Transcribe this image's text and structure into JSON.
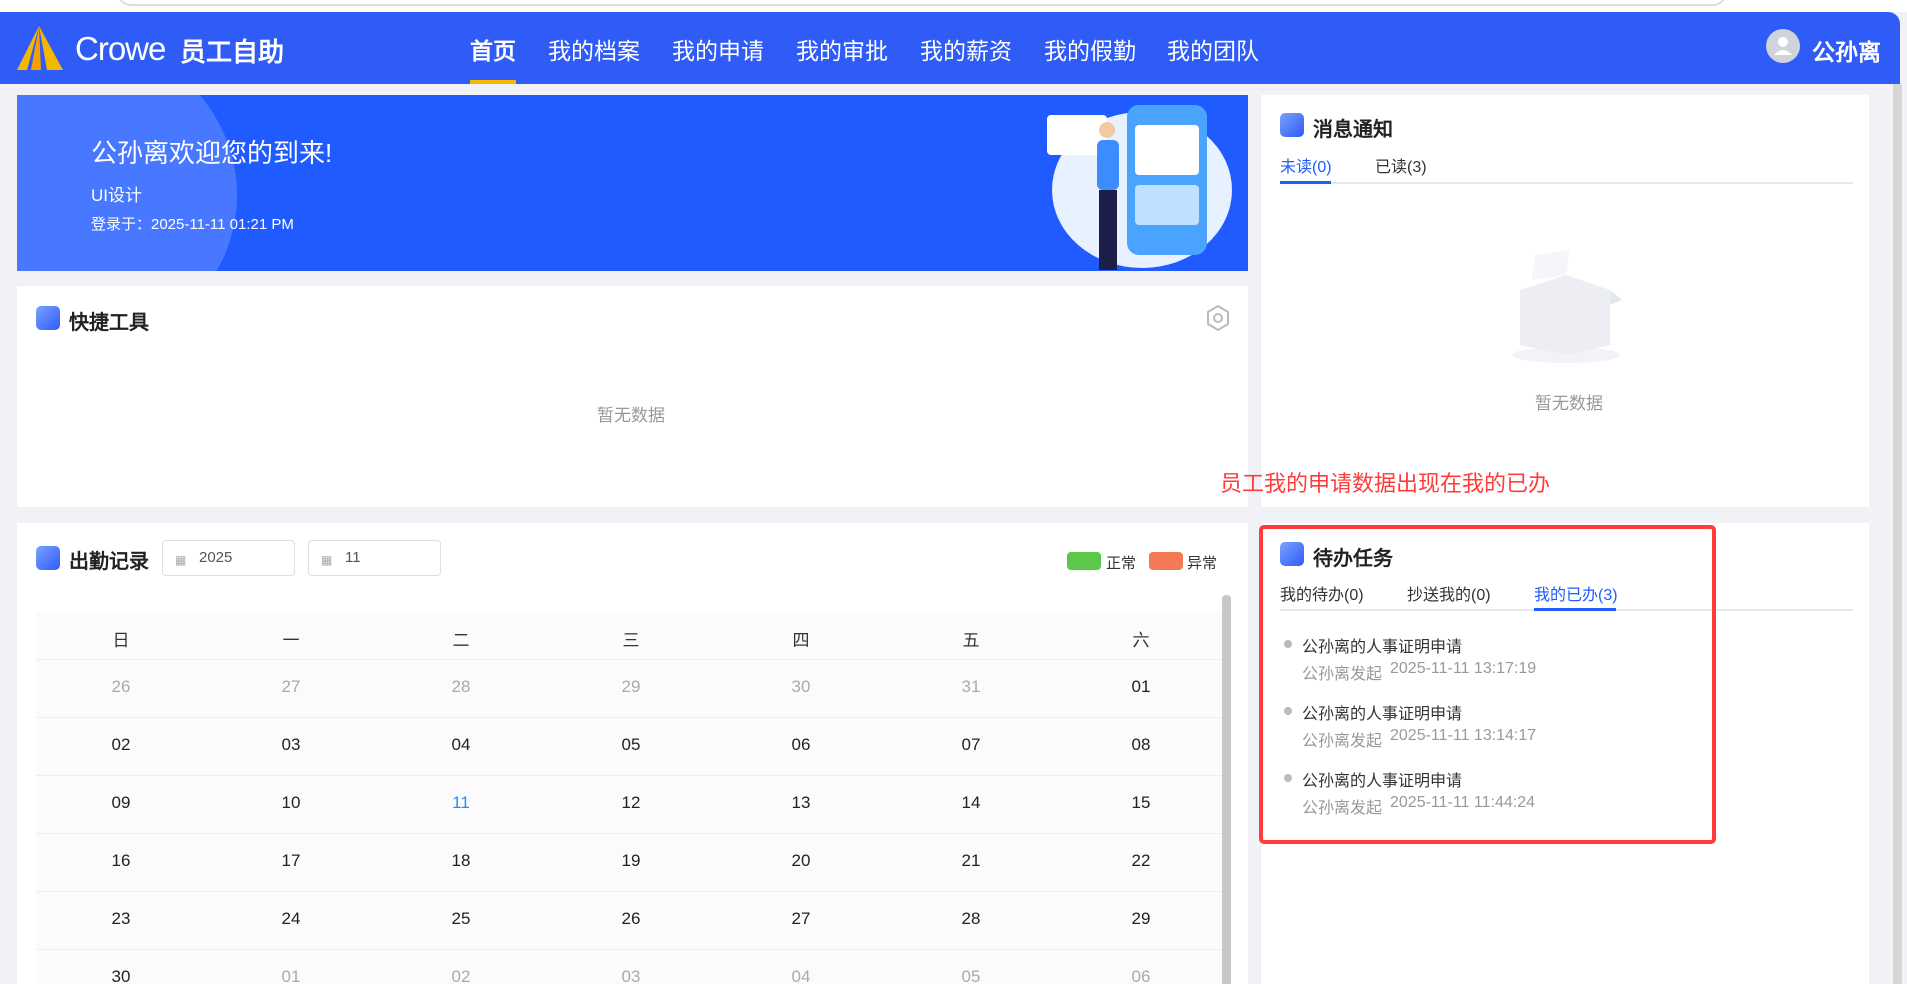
{
  "header": {
    "logo_text": "Crowe",
    "app_name": "员工自助",
    "nav": [
      "首页",
      "我的档案",
      "我的申请",
      "我的审批",
      "我的薪资",
      "我的假勤",
      "我的团队"
    ],
    "active_nav": 0,
    "user_name": "公孙离"
  },
  "banner": {
    "welcome": "公孙离欢迎您的到来!",
    "position": "UI设计",
    "login_time": "登录于：2025-11-11 01:21 PM"
  },
  "quick_tools": {
    "title": "快捷工具",
    "empty": "暂无数据"
  },
  "attendance": {
    "title": "出勤记录",
    "year": "2025",
    "month": "11",
    "legend": [
      {
        "label": "正常",
        "color": "#5cc84a"
      },
      {
        "label": "异常",
        "color": "#f47a55"
      }
    ],
    "weekdays": [
      "日",
      "一",
      "二",
      "三",
      "四",
      "五",
      "六"
    ],
    "weeks": [
      [
        "26",
        "27",
        "28",
        "29",
        "30",
        "31",
        "01"
      ],
      [
        "02",
        "03",
        "04",
        "05",
        "06",
        "07",
        "08"
      ],
      [
        "09",
        "10",
        "11",
        "12",
        "13",
        "14",
        "15"
      ],
      [
        "16",
        "17",
        "18",
        "19",
        "20",
        "21",
        "22"
      ],
      [
        "23",
        "24",
        "25",
        "26",
        "27",
        "28",
        "29"
      ],
      [
        "30",
        "01",
        "02",
        "03",
        "04",
        "05",
        "06"
      ]
    ],
    "today": "11"
  },
  "messages": {
    "title": "消息通知",
    "tabs": [
      "未读(0)",
      "已读(3)"
    ],
    "empty": "暂无数据"
  },
  "annotation": "员工我的申请数据出现在我的已办",
  "tasks": {
    "title": "待办任务",
    "tabs": [
      "我的待办(0)",
      "抄送我的(0)",
      "我的已办(3)"
    ],
    "active_tab": 2,
    "items": [
      {
        "title": "公孙离的人事证明申请",
        "initiator": "公孙离发起",
        "time": "2025-11-11 13:17:19"
      },
      {
        "title": "公孙离的人事证明申请",
        "initiator": "公孙离发起",
        "time": "2025-11-11 13:14:17"
      },
      {
        "title": "公孙离的人事证明申请",
        "initiator": "公孙离发起",
        "time": "2025-11-11 11:44:24"
      }
    ]
  }
}
